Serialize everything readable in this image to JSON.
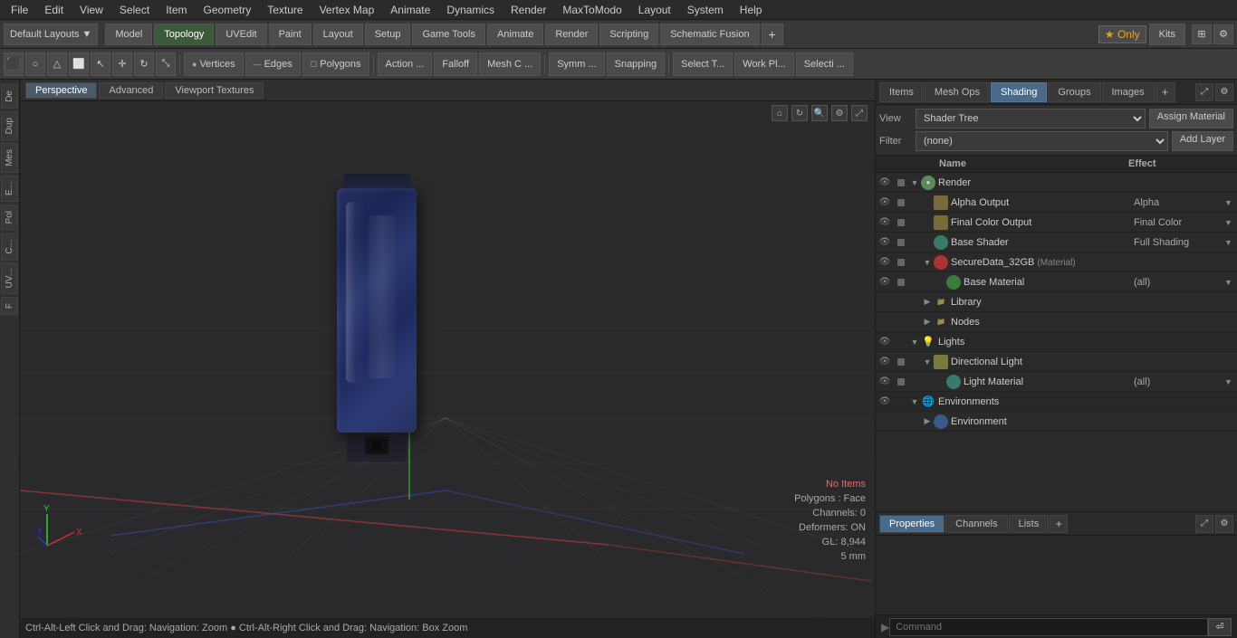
{
  "menu": {
    "items": [
      "File",
      "Edit",
      "View",
      "Select",
      "Item",
      "Geometry",
      "Texture",
      "Vertex Map",
      "Animate",
      "Dynamics",
      "Render",
      "MaxToModo",
      "Layout",
      "System",
      "Help"
    ]
  },
  "toolbar": {
    "layouts_dropdown": "Default Layouts",
    "tabs": [
      "Model",
      "Topology",
      "UVEdit",
      "Paint",
      "Layout",
      "Setup",
      "Game Tools",
      "Animate",
      "Render",
      "Scripting",
      "Schematic Fusion"
    ],
    "active_tab": "Render",
    "plus_label": "+",
    "only_label": "Only",
    "kits_label": "Kits"
  },
  "mode_bar": {
    "buttons": [
      "Vertices",
      "Edges",
      "Polygons",
      "Action ...",
      "Falloff",
      "Mesh C ...",
      "Symm ...",
      "Snapping",
      "Select T...",
      "Work Pl...",
      "Selecti ..."
    ],
    "right": [
      "Kits"
    ]
  },
  "viewport": {
    "tabs": [
      "Perspective",
      "Advanced",
      "Viewport Textures"
    ],
    "active_tab": "Perspective"
  },
  "scene": {
    "status": {
      "no_items": "No Items",
      "polygons": "Polygons : Face",
      "channels": "Channels: 0",
      "deformers": "Deformers: ON",
      "gl": "GL: 8,944",
      "unit": "5 mm"
    }
  },
  "right_panel": {
    "tabs": [
      "Items",
      "Mesh Ops",
      "Shading",
      "Groups",
      "Images"
    ],
    "active_tab": "Shading",
    "view_label": "View",
    "view_value": "Shader Tree",
    "filter_label": "Filter",
    "filter_value": "(none)",
    "assign_material_btn": "Assign Material",
    "add_layer_btn": "Add Layer",
    "tree_headers": {
      "name": "Name",
      "effect": "Effect"
    },
    "tree_items": [
      {
        "id": "render",
        "indent": 0,
        "has_eye": true,
        "has_vis": true,
        "arrow": "▼",
        "icon": "render",
        "name": "Render",
        "effect": "",
        "has_dropdown": false,
        "level": 0
      },
      {
        "id": "alpha-output",
        "indent": 1,
        "has_eye": true,
        "has_vis": true,
        "arrow": "",
        "icon": "output",
        "name": "Alpha Output",
        "effect": "Alpha",
        "has_dropdown": true,
        "level": 1
      },
      {
        "id": "final-color-output",
        "indent": 1,
        "has_eye": true,
        "has_vis": true,
        "arrow": "",
        "icon": "output",
        "name": "Final Color Output",
        "effect": "Final Color",
        "has_dropdown": true,
        "level": 1
      },
      {
        "id": "base-shader",
        "indent": 1,
        "has_eye": true,
        "has_vis": true,
        "arrow": "",
        "icon": "shader",
        "name": "Base Shader",
        "effect": "Full Shading",
        "has_dropdown": true,
        "level": 1
      },
      {
        "id": "securedata",
        "indent": 1,
        "has_eye": true,
        "has_vis": true,
        "arrow": "▼",
        "icon": "material-red",
        "name": "SecureData_32GB",
        "material_tag": "(Material)",
        "effect": "",
        "has_dropdown": false,
        "level": 1
      },
      {
        "id": "base-material",
        "indent": 2,
        "has_eye": true,
        "has_vis": true,
        "arrow": "",
        "icon": "material-green",
        "name": "Base Material",
        "effect": "(all)",
        "has_dropdown": true,
        "level": 2
      },
      {
        "id": "library",
        "indent": 1,
        "has_eye": false,
        "has_vis": false,
        "arrow": "▶",
        "icon": "folder",
        "name": "Library",
        "effect": "",
        "has_dropdown": false,
        "level": 1
      },
      {
        "id": "nodes",
        "indent": 1,
        "has_eye": false,
        "has_vis": false,
        "arrow": "▶",
        "icon": "folder",
        "name": "Nodes",
        "effect": "",
        "has_dropdown": false,
        "level": 1
      },
      {
        "id": "lights",
        "indent": 0,
        "has_eye": true,
        "has_vis": false,
        "arrow": "▼",
        "icon": "folder",
        "name": "Lights",
        "effect": "",
        "has_dropdown": false,
        "level": 0
      },
      {
        "id": "directional-light",
        "indent": 1,
        "has_eye": true,
        "has_vis": true,
        "arrow": "▼",
        "icon": "light-dir",
        "name": "Directional Light",
        "effect": "",
        "has_dropdown": false,
        "level": 1
      },
      {
        "id": "light-material",
        "indent": 2,
        "has_eye": true,
        "has_vis": true,
        "arrow": "",
        "icon": "light-mat",
        "name": "Light Material",
        "effect": "(all)",
        "has_dropdown": true,
        "level": 2
      },
      {
        "id": "environments",
        "indent": 0,
        "has_eye": true,
        "has_vis": false,
        "arrow": "▼",
        "icon": "folder",
        "name": "Environments",
        "effect": "",
        "has_dropdown": false,
        "level": 0
      },
      {
        "id": "environment",
        "indent": 1,
        "has_eye": false,
        "has_vis": false,
        "arrow": "▶",
        "icon": "env",
        "name": "Environment",
        "effect": "",
        "has_dropdown": false,
        "level": 1
      }
    ]
  },
  "bottom_panel": {
    "tabs": [
      "Properties",
      "Channels",
      "Lists"
    ],
    "active_tab": "Properties",
    "plus_label": "+"
  },
  "command_bar": {
    "placeholder": "Command",
    "arrow": "▶"
  },
  "status_bar": {
    "text": "Ctrl-Alt-Left Click and Drag: Navigation: Zoom  ●  Ctrl-Alt-Right Click and Drag: Navigation: Box Zoom"
  }
}
